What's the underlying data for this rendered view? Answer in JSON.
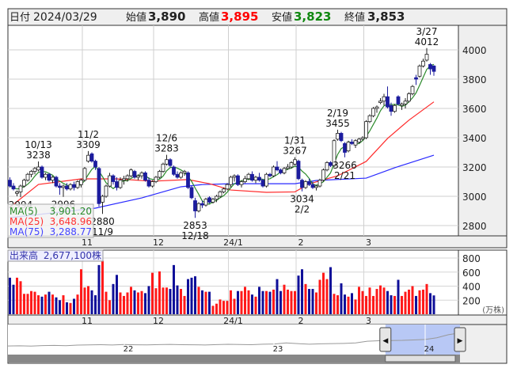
{
  "header": {
    "date_label": "日付",
    "date": "2024/03/29",
    "open_label": "始値",
    "open": "3,890",
    "high_label": "高値",
    "high": "3,895",
    "low_label": "安値",
    "low": "3,823",
    "close_label": "終値",
    "close": "3,853"
  },
  "legend": {
    "ma5_label": "MA(5)",
    "ma5_value": "3,901.20",
    "ma25_label": "MA(25)",
    "ma25_value": "3,648.96",
    "ma75_label": "MA(75)",
    "ma75_value": "3,288.77"
  },
  "volume_legend": {
    "label": "出来高",
    "value": "2,677,100株"
  },
  "volume_unit": "(万株)",
  "colors": {
    "up_body": "#ffffff",
    "down_body": "#1c1c9e",
    "vol_up": "#ff1a1a",
    "vol_down": "#0f0f99",
    "ma5": "#2a8a2a",
    "ma25": "#ff2a2a",
    "ma75": "#2a2aff",
    "high": "#ff0000",
    "low": "#118811"
  },
  "chart_data": {
    "type": "candlestick",
    "title": "",
    "price_ticks": [
      "4000",
      "3800",
      "3600",
      "3400",
      "3200",
      "3000",
      "2800"
    ],
    "price_range": [
      2730,
      4170
    ],
    "volume_ticks": [
      "800",
      "600",
      "400",
      "200"
    ],
    "volume_range": [
      0,
      880
    ],
    "month_labels": [
      {
        "index": 21,
        "label": "11"
      },
      {
        "index": 41,
        "label": "12"
      },
      {
        "index": 62,
        "label": "24/1"
      },
      {
        "index": 81,
        "label": "2"
      },
      {
        "index": 100,
        "label": "3"
      }
    ],
    "ohlc": [
      [
        3110,
        3130,
        3060,
        3070
      ],
      [
        3070,
        3090,
        3040,
        3050
      ],
      [
        3020,
        3040,
        3000,
        3030
      ],
      [
        3030,
        3080,
        2994,
        3070
      ],
      [
        3070,
        3120,
        3060,
        3110
      ],
      [
        3110,
        3160,
        3100,
        3150
      ],
      [
        3150,
        3180,
        3130,
        3170
      ],
      [
        3170,
        3200,
        3150,
        3190
      ],
      [
        3180,
        3238,
        3170,
        3200
      ],
      [
        3200,
        3210,
        3120,
        3130
      ],
      [
        3130,
        3160,
        3110,
        3150
      ],
      [
        3150,
        3160,
        3100,
        3110
      ],
      [
        3110,
        3140,
        3090,
        3130
      ],
      [
        3130,
        3140,
        3060,
        3070
      ],
      [
        3070,
        3090,
        3010,
        3060
      ],
      [
        3060,
        3080,
        2996,
        3070
      ],
      [
        3070,
        3090,
        3040,
        3050
      ],
      [
        3050,
        3090,
        3040,
        3080
      ],
      [
        3080,
        3100,
        3040,
        3060
      ],
      [
        3060,
        3110,
        3050,
        3100
      ],
      [
        3080,
        3120,
        3060,
        3110
      ],
      [
        3110,
        3200,
        3100,
        3190
      ],
      [
        3240,
        3309,
        3230,
        3280
      ],
      [
        3290,
        3300,
        3230,
        3240
      ],
      [
        3240,
        3250,
        3180,
        3200
      ],
      [
        3190,
        3200,
        2930,
        2950
      ],
      [
        2960,
        3010,
        2880,
        3000
      ],
      [
        3000,
        3080,
        2990,
        3070
      ],
      [
        3070,
        3160,
        3060,
        3140
      ],
      [
        3140,
        3150,
        3080,
        3100
      ],
      [
        3100,
        3130,
        3040,
        3060
      ],
      [
        3060,
        3130,
        3050,
        3110
      ],
      [
        3110,
        3140,
        3080,
        3120
      ],
      [
        3120,
        3150,
        3100,
        3140
      ],
      [
        3140,
        3190,
        3130,
        3180
      ],
      [
        3170,
        3180,
        3120,
        3130
      ],
      [
        3130,
        3150,
        3110,
        3140
      ],
      [
        3140,
        3170,
        3120,
        3160
      ],
      [
        3160,
        3170,
        3100,
        3110
      ],
      [
        3110,
        3130,
        3060,
        3070
      ],
      [
        3070,
        3110,
        3060,
        3100
      ],
      [
        3100,
        3140,
        3090,
        3130
      ],
      [
        3130,
        3180,
        3120,
        3170
      ],
      [
        3170,
        3230,
        3160,
        3220
      ],
      [
        3220,
        3283,
        3210,
        3250
      ],
      [
        3250,
        3260,
        3200,
        3210
      ],
      [
        3200,
        3210,
        3140,
        3150
      ],
      [
        3150,
        3170,
        3120,
        3130
      ],
      [
        3130,
        3170,
        3120,
        3160
      ],
      [
        3160,
        3180,
        3140,
        3170
      ],
      [
        3160,
        3170,
        3050,
        3060
      ],
      [
        3060,
        3070,
        2980,
        2990
      ],
      [
        2970,
        2990,
        2853,
        2900
      ],
      [
        2900,
        2960,
        2890,
        2950
      ],
      [
        2950,
        2970,
        2920,
        2940
      ],
      [
        2940,
        2990,
        2930,
        2980
      ],
      [
        2990,
        3000,
        2950,
        2960
      ],
      [
        2960,
        2990,
        2950,
        2980
      ],
      [
        2980,
        3010,
        2960,
        3000
      ],
      [
        3000,
        3040,
        2990,
        3030
      ],
      [
        3030,
        3060,
        3020,
        3050
      ],
      [
        3050,
        3090,
        3040,
        3080
      ],
      [
        3080,
        3140,
        3060,
        3130
      ],
      [
        3130,
        3150,
        3100,
        3140
      ],
      [
        3140,
        3150,
        3070,
        3080
      ],
      [
        3080,
        3110,
        3060,
        3100
      ],
      [
        3100,
        3140,
        3090,
        3120
      ],
      [
        3120,
        3160,
        3110,
        3150
      ],
      [
        3150,
        3170,
        3100,
        3110
      ],
      [
        3110,
        3140,
        3090,
        3130
      ],
      [
        3130,
        3160,
        3100,
        3110
      ],
      [
        3110,
        3120,
        3060,
        3070
      ],
      [
        3070,
        3160,
        3060,
        3150
      ],
      [
        3150,
        3160,
        3130,
        3140
      ],
      [
        3140,
        3210,
        3130,
        3200
      ],
      [
        3200,
        3240,
        3170,
        3180
      ],
      [
        3180,
        3190,
        3150,
        3160
      ],
      [
        3160,
        3200,
        3150,
        3190
      ],
      [
        3190,
        3220,
        3180,
        3200
      ],
      [
        3200,
        3240,
        3190,
        3230
      ],
      [
        3220,
        3267,
        3210,
        3250
      ],
      [
        3240,
        3250,
        3110,
        3120
      ],
      [
        3110,
        3120,
        3034,
        3060
      ],
      [
        3060,
        3110,
        3050,
        3100
      ],
      [
        3100,
        3120,
        3070,
        3080
      ],
      [
        3080,
        3100,
        3050,
        3060
      ],
      [
        3060,
        3080,
        3040,
        3070
      ],
      [
        3070,
        3120,
        3060,
        3110
      ],
      [
        3110,
        3190,
        3100,
        3180
      ],
      [
        3180,
        3240,
        3170,
        3230
      ],
      [
        3230,
        3240,
        3200,
        3210
      ],
      [
        3210,
        3390,
        3200,
        3380
      ],
      [
        3390,
        3455,
        3380,
        3430
      ],
      [
        3430,
        3440,
        3370,
        3380
      ],
      [
        3360,
        3370,
        3266,
        3300
      ],
      [
        3310,
        3380,
        3300,
        3370
      ],
      [
        3370,
        3390,
        3350,
        3360
      ],
      [
        3350,
        3390,
        3330,
        3380
      ],
      [
        3370,
        3400,
        3360,
        3390
      ],
      [
        3390,
        3410,
        3380,
        3400
      ],
      [
        3400,
        3520,
        3390,
        3510
      ],
      [
        3510,
        3560,
        3500,
        3550
      ],
      [
        3550,
        3610,
        3540,
        3600
      ],
      [
        3600,
        3620,
        3570,
        3610
      ],
      [
        3640,
        3670,
        3630,
        3650
      ],
      [
        3650,
        3700,
        3620,
        3680
      ],
      [
        3680,
        3750,
        3600,
        3610
      ],
      [
        3620,
        3640,
        3550,
        3580
      ],
      [
        3580,
        3630,
        3570,
        3620
      ],
      [
        3680,
        3690,
        3620,
        3630
      ],
      [
        3620,
        3640,
        3590,
        3630
      ],
      [
        3630,
        3670,
        3600,
        3650
      ],
      [
        3650,
        3710,
        3640,
        3700
      ],
      [
        3700,
        3760,
        3690,
        3750
      ],
      [
        3810,
        3830,
        3760,
        3800
      ],
      [
        3820,
        3900,
        3810,
        3890
      ],
      [
        3890,
        3940,
        3880,
        3923
      ],
      [
        3930,
        4012,
        3920,
        3970
      ],
      [
        3900,
        3910,
        3830,
        3870
      ],
      [
        3890,
        3895,
        3823,
        3853
      ]
    ],
    "volume": [
      520,
      420,
      520,
      470,
      290,
      290,
      330,
      320,
      270,
      250,
      280,
      320,
      280,
      240,
      200,
      270,
      170,
      160,
      220,
      280,
      640,
      380,
      400,
      340,
      270,
      700,
      760,
      320,
      200,
      430,
      560,
      310,
      260,
      310,
      390,
      340,
      310,
      330,
      300,
      400,
      590,
      370,
      610,
      380,
      380,
      360,
      700,
      410,
      360,
      260,
      500,
      520,
      540,
      390,
      340,
      320,
      320,
      120,
      150,
      210,
      190,
      190,
      340,
      220,
      330,
      330,
      390,
      340,
      280,
      250,
      390,
      330,
      330,
      320,
      350,
      500,
      330,
      420,
      350,
      330,
      330,
      550,
      640,
      430,
      360,
      360,
      310,
      490,
      590,
      500,
      670,
      290,
      270,
      440,
      280,
      250,
      300,
      210,
      390,
      330,
      260,
      380,
      260,
      360,
      410,
      380,
      330,
      270,
      260,
      490,
      260,
      320,
      350,
      400,
      260,
      340,
      350,
      430,
      300,
      267.71
    ],
    "ma25_points": [
      [
        0,
        2925
      ],
      [
        8,
        3081
      ],
      [
        20,
        3119
      ],
      [
        30,
        3119
      ],
      [
        40,
        3103
      ],
      [
        50,
        3114
      ],
      [
        56,
        3086
      ],
      [
        62,
        3043
      ],
      [
        72,
        3027
      ],
      [
        80,
        3030
      ],
      [
        84,
        3085
      ],
      [
        92,
        3140
      ],
      [
        100,
        3238
      ],
      [
        106,
        3395
      ],
      [
        112,
        3520
      ],
      [
        119,
        3645
      ]
    ],
    "ma75_points": [
      [
        0,
        2854
      ],
      [
        24,
        2919
      ],
      [
        37,
        2989
      ],
      [
        48,
        3065
      ],
      [
        54,
        3080
      ],
      [
        62,
        3086
      ],
      [
        80,
        3086
      ],
      [
        86,
        3108
      ],
      [
        100,
        3124
      ],
      [
        108,
        3195
      ],
      [
        119,
        3281
      ]
    ],
    "annotations": [
      {
        "index": 8,
        "type": "high",
        "date": "10/13",
        "value": "3238"
      },
      {
        "index": 3,
        "type": "low",
        "date": "",
        "value": "2994"
      },
      {
        "index": 15,
        "type": "low",
        "date": "",
        "value": "2996"
      },
      {
        "index": 22,
        "type": "high",
        "date": "11/2",
        "value": "3309"
      },
      {
        "index": 26,
        "type": "low",
        "date": "11/9",
        "value": "2880"
      },
      {
        "index": 44,
        "type": "high",
        "date": "12/6",
        "value": "3283"
      },
      {
        "index": 52,
        "type": "low",
        "date": "12/18",
        "value": "2853"
      },
      {
        "index": 80,
        "type": "high",
        "date": "1/31",
        "value": "3267"
      },
      {
        "index": 82,
        "type": "low",
        "date": "2/2",
        "value": "3034"
      },
      {
        "index": 92,
        "type": "high",
        "date": "2/19",
        "value": "3455"
      },
      {
        "index": 94,
        "type": "low",
        "date": "2/21",
        "value": "3266"
      },
      {
        "index": 117,
        "type": "high",
        "date": "3/27",
        "value": "4012"
      }
    ],
    "navigator": {
      "year_labels": [
        "22",
        "23",
        "24"
      ],
      "series": [
        2350,
        2380,
        2340,
        2400,
        2420,
        2390,
        2450,
        2480,
        2500,
        2470,
        2520,
        2490,
        2480,
        2510,
        2530,
        2500,
        2490,
        2470,
        2510,
        2540,
        2520,
        2500,
        2560,
        2580,
        2700,
        2620,
        2560,
        2600,
        2620,
        2650,
        2700,
        2900,
        2950,
        2980,
        3000,
        3050,
        3100,
        3300,
        3650,
        3850
      ],
      "selection_fraction": [
        0.835,
        1.0
      ]
    }
  }
}
